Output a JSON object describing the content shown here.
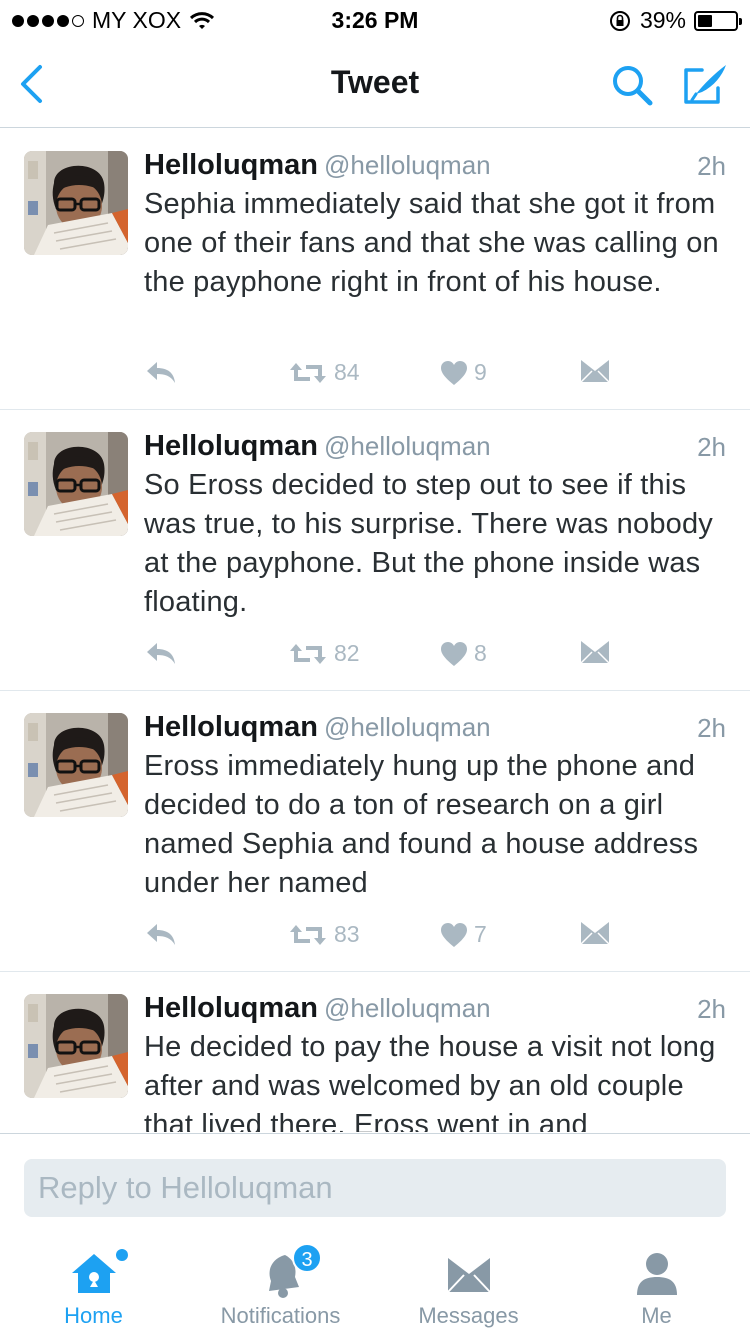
{
  "status_bar": {
    "carrier": "MY XOX",
    "time": "3:26 PM",
    "battery": "39%",
    "battery_level": 0.39,
    "signal_bars": 4
  },
  "nav": {
    "title": "Tweet"
  },
  "colors": {
    "accent": "#1da1f2",
    "muted": "#8899a6",
    "icon_muted": "#aab8c2"
  },
  "tweets": [
    {
      "name": "Helloluqman",
      "handle": "@helloluqman",
      "time": "2h",
      "text": "Sephia immediately said that she got it from one of their fans and that she was calling on the payphone right in front of his house.",
      "retweets": "84",
      "likes": "9"
    },
    {
      "name": "Helloluqman",
      "handle": "@helloluqman",
      "time": "2h",
      "text": "So Eross decided to step out to see if this was true, to his surprise. There was nobody at the payphone. But the phone inside was floating.",
      "retweets": "82",
      "likes": "8"
    },
    {
      "name": "Helloluqman",
      "handle": "@helloluqman",
      "time": "2h",
      "text": "Eross immediately hung up the phone and decided to do a ton of research on a girl named Sephia and found a house address under her named",
      "retweets": "83",
      "likes": "7"
    },
    {
      "name": "Helloluqman",
      "handle": "@helloluqman",
      "time": "2h",
      "text": "He decided to pay the house a visit not long after and was welcomed by an old couple that lived there. Eross went in and",
      "retweets": "",
      "likes": ""
    }
  ],
  "reply": {
    "placeholder": "Reply to Helloluqman"
  },
  "tabs": {
    "home": "Home",
    "notifications": "Notifications",
    "notifications_badge": "3",
    "messages": "Messages",
    "me": "Me"
  }
}
